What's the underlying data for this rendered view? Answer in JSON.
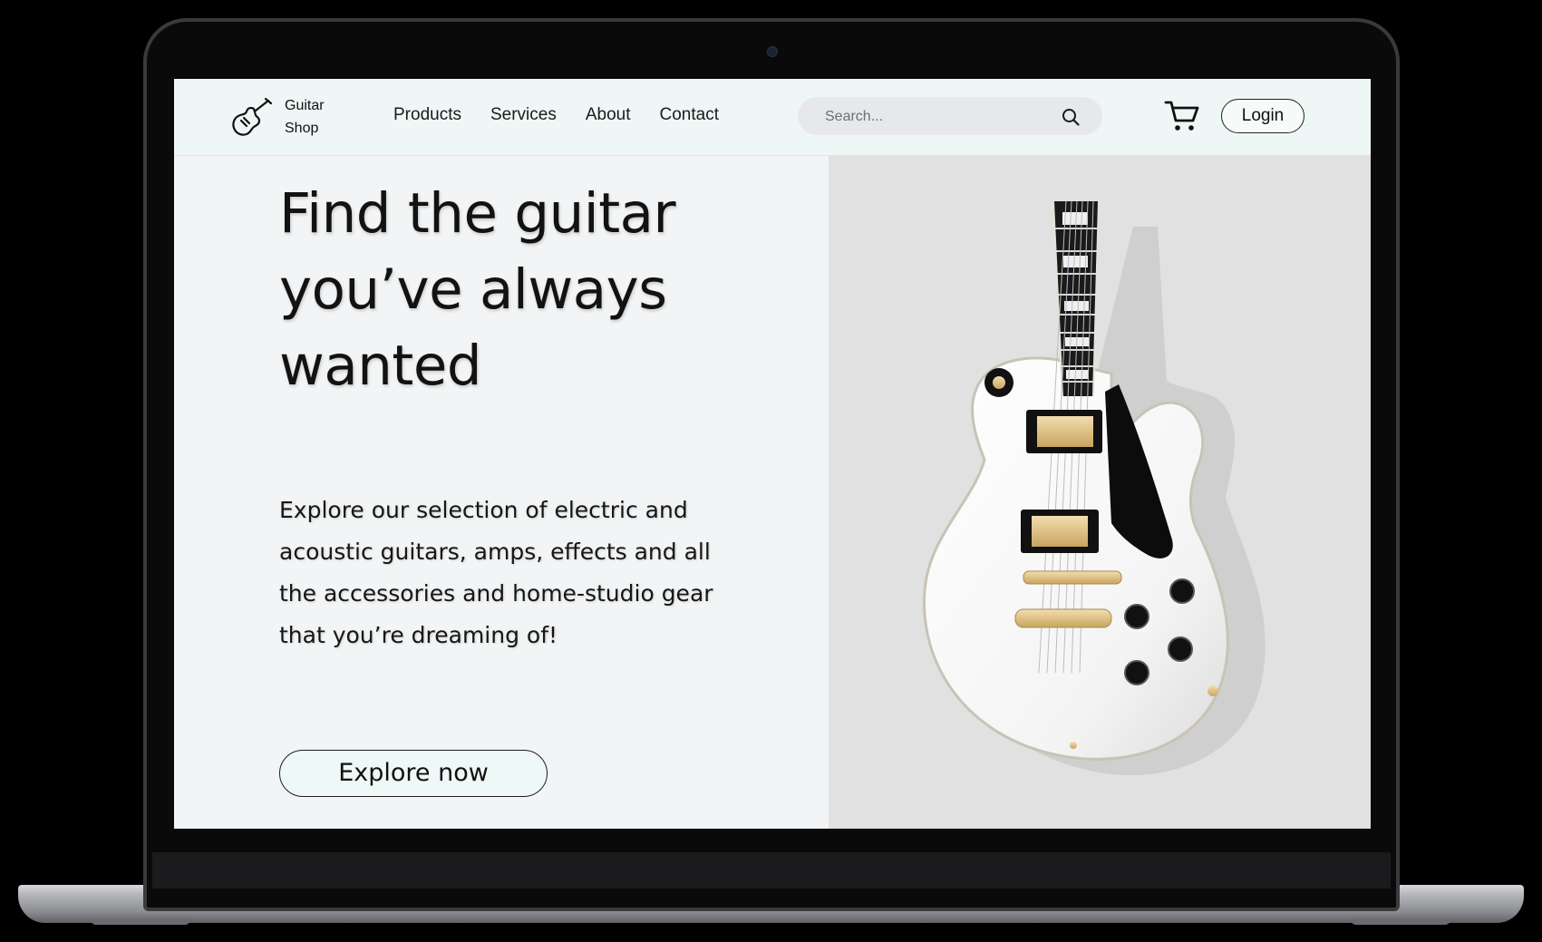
{
  "header": {
    "logo_line1": "Guitar",
    "logo_line2": "Shop",
    "logo_icon": "electric-guitar-icon",
    "nav": [
      "Products",
      "Services",
      "About",
      "Contact"
    ],
    "search_placeholder": "Search...",
    "search_icon": "magnifier-icon",
    "cart_icon": "shopping-cart-icon",
    "login_label": "Login"
  },
  "hero": {
    "headline": "Find the guitar you’ve always wanted",
    "description": "Explore our selection of electric and acoustic guitars, amps, effects and all the accessories and home-studio gear that you’re dreaming of!",
    "cta_label": "Explore now",
    "image_subject": "white-les-paul-style-electric-guitar"
  },
  "colors": {
    "navbar_bg": "#eef7f6",
    "hero_left_bg": "#f2f4f5",
    "hero_right_bg": "#e1e1e1",
    "search_bg": "#e6e8ea",
    "text": "#121212"
  }
}
